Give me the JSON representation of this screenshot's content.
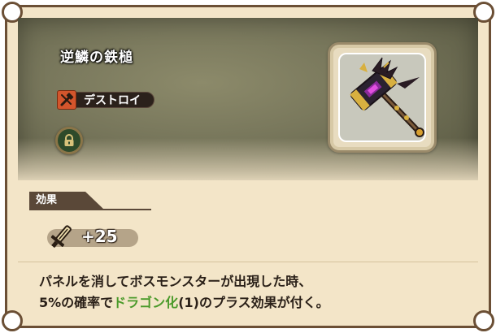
{
  "item": {
    "name": "逆鱗の鉄槌",
    "category_label": "デストロイ",
    "category_icon": "hammer-cross-icon",
    "lock_icon": "lock-icon"
  },
  "effect": {
    "section_label": "効果",
    "bonus_icon": "sword-icon",
    "bonus_value": "+25"
  },
  "description": {
    "line1": "パネルを消してボスモンスターが出現した時、",
    "line2_pre": "5%の確率で",
    "line2_highlight": "ドラゴン化",
    "line2_post": "(1)のプラス効果が付く。"
  },
  "colors": {
    "card_bg": "#f3e5c8",
    "border": "#6b4f35",
    "highlight": "#4a9a2a",
    "category_icon_bg": "#d3552c"
  }
}
